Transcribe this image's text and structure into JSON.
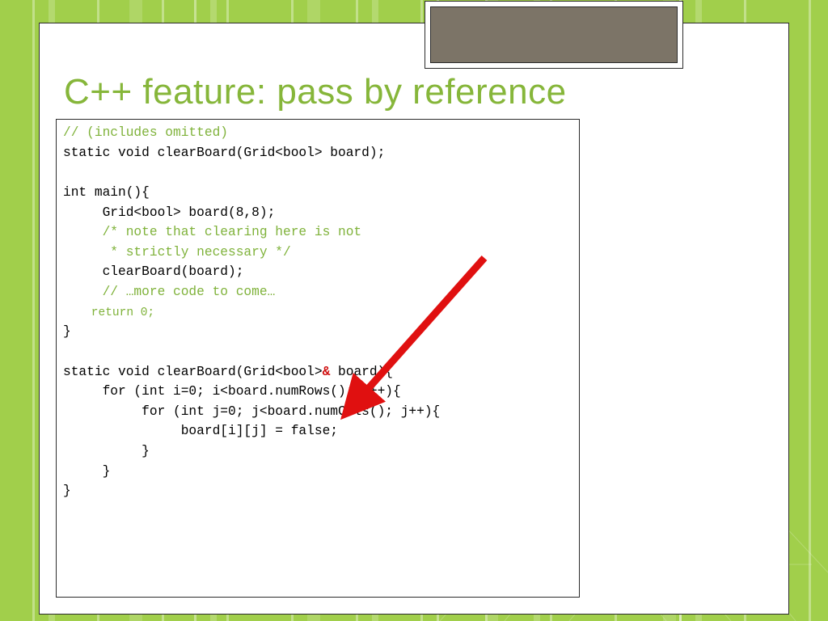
{
  "slide": {
    "title": "C++ feature: pass by reference"
  },
  "code": {
    "c_includes": "// (includes omitted)",
    "proto": "static void clearBoard(Grid<bool> board);",
    "main_sig": "int main(){",
    "main_l1": "     Grid<bool> board(8,8);",
    "c_note1": "     /* note that clearing here is not",
    "c_note2": "      * strictly necessary */",
    "main_l2": "     clearBoard(board);",
    "c_more": "     // …more code to come…",
    "ret": "    return 0;",
    "close1": "}",
    "fn_sig_pre": "static void clearBoard(Grid<bool>",
    "fn_amp": "&",
    "fn_sig_post": " board){",
    "fn_l1": "     for (int i=0; i<board.numRows(); i++){",
    "fn_l2": "          for (int j=0; j<board.numCols(); j++){",
    "fn_l3": "               board[i][j] = false;",
    "fn_l4": "          }",
    "fn_l5": "     }",
    "close2": "}"
  }
}
